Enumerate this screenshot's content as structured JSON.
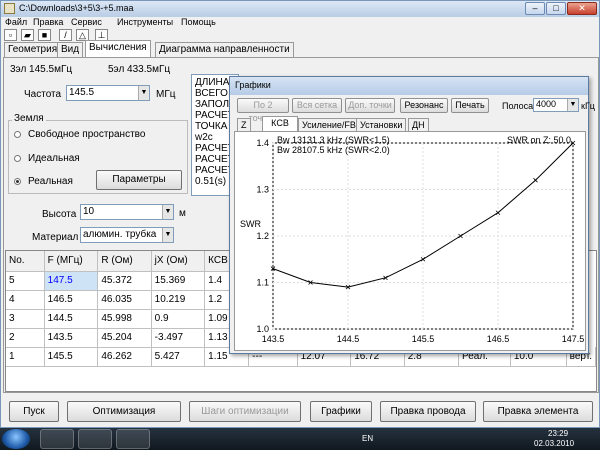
{
  "window": {
    "title": "C:\\Downloads\\3+5\\3-+5.maa"
  },
  "menu": [
    "Файл",
    "Правка",
    "Сервис",
    "Инструменты",
    "Помощь"
  ],
  "tabs": [
    "Геометрия",
    "Вид",
    "Вычисления",
    "Диаграмма направленности"
  ],
  "active_tab": "Вычисления",
  "info": {
    "left": "3эл 145.5мГц",
    "right": "5эл 433.5мГц"
  },
  "frequency": {
    "label": "Частота",
    "value": "145.5",
    "unit": "МГц"
  },
  "ground": {
    "group_label": "Земля",
    "options": [
      "Свободное пространство",
      "Идеальная",
      "Реальная"
    ],
    "selected": "Реальная",
    "params_button": "Параметры"
  },
  "height": {
    "label": "Высота",
    "value": "10",
    "unit": "м"
  },
  "material": {
    "label": "Материал",
    "value": "алюмин. трубка"
  },
  "results_memo": [
    "ДЛИНА",
    "ВСЕГО",
    "ЗАПОЛН",
    "РАСЧЕТ",
    "ТОЧКА",
    "w2c",
    "РАСЧЕТ",
    "РАСЧЕТ",
    "РАСЧЕТ",
    "0.51(s)"
  ],
  "table": {
    "headers": [
      "No.",
      "F (МГц)",
      "R (Ом)",
      "jX (Ом)",
      "КСВ"
    ],
    "rows": [
      [
        "5",
        "147.5",
        "45.372",
        "15.369",
        "1.4"
      ],
      [
        "4",
        "146.5",
        "46.035",
        "10.219",
        "1.2"
      ],
      [
        "3",
        "144.5",
        "45.998",
        "0.9",
        "1.09"
      ],
      [
        "2",
        "143.5",
        "45.204",
        "-3.497",
        "1.13"
      ],
      [
        "1",
        "145.5",
        "46.262",
        "5.427",
        "1.15"
      ]
    ],
    "row1_extra": [
      "---",
      "12.07",
      "16.72",
      "2.8",
      "Реал.",
      "10.0",
      "верт."
    ]
  },
  "bottom_buttons": [
    "Пуск",
    "Оптимизация",
    "Шаги оптимизации",
    "Графики",
    "Правка провода",
    "Правка элемента"
  ],
  "graph_window": {
    "title": "Графики",
    "buttons": [
      "По 2 точкам",
      "Вся сетка",
      "Доп. точки",
      "Резонанс",
      "Печать"
    ],
    "band_label": "Полоса",
    "band_value": "4000",
    "band_unit": "кГц",
    "tabs": [
      "Z",
      "КСВ",
      "Усиление/FB",
      "Установки",
      "ДН"
    ],
    "active_tab": "КСВ",
    "annotations": [
      "Bw 13131.3 kHz (SWR<1.5)",
      "Bw 28107.5 kHz (SWR<2.0)"
    ],
    "swr_note": "SWR on Z: 50.0",
    "ylabel": "SWR"
  },
  "chart_data": {
    "type": "line",
    "xlabel": "",
    "ylabel": "SWR",
    "xlim": [
      143.5,
      147.5
    ],
    "ylim": [
      1.0,
      1.4
    ],
    "x_ticks": [
      "143.5",
      "144.5",
      "145.5",
      "146.5",
      "147.5"
    ],
    "y_ticks": [
      "1.0",
      "1.1",
      "1.2",
      "1.3",
      "1.4"
    ],
    "x": [
      143.5,
      144.0,
      144.5,
      145.0,
      145.5,
      146.0,
      146.5,
      147.0,
      147.5
    ],
    "y": [
      1.13,
      1.1,
      1.09,
      1.11,
      1.15,
      1.2,
      1.25,
      1.32,
      1.4
    ],
    "color": "#000000"
  },
  "taskbar": {
    "lang": "EN",
    "time": "23:29",
    "date": "02.03.2010"
  }
}
